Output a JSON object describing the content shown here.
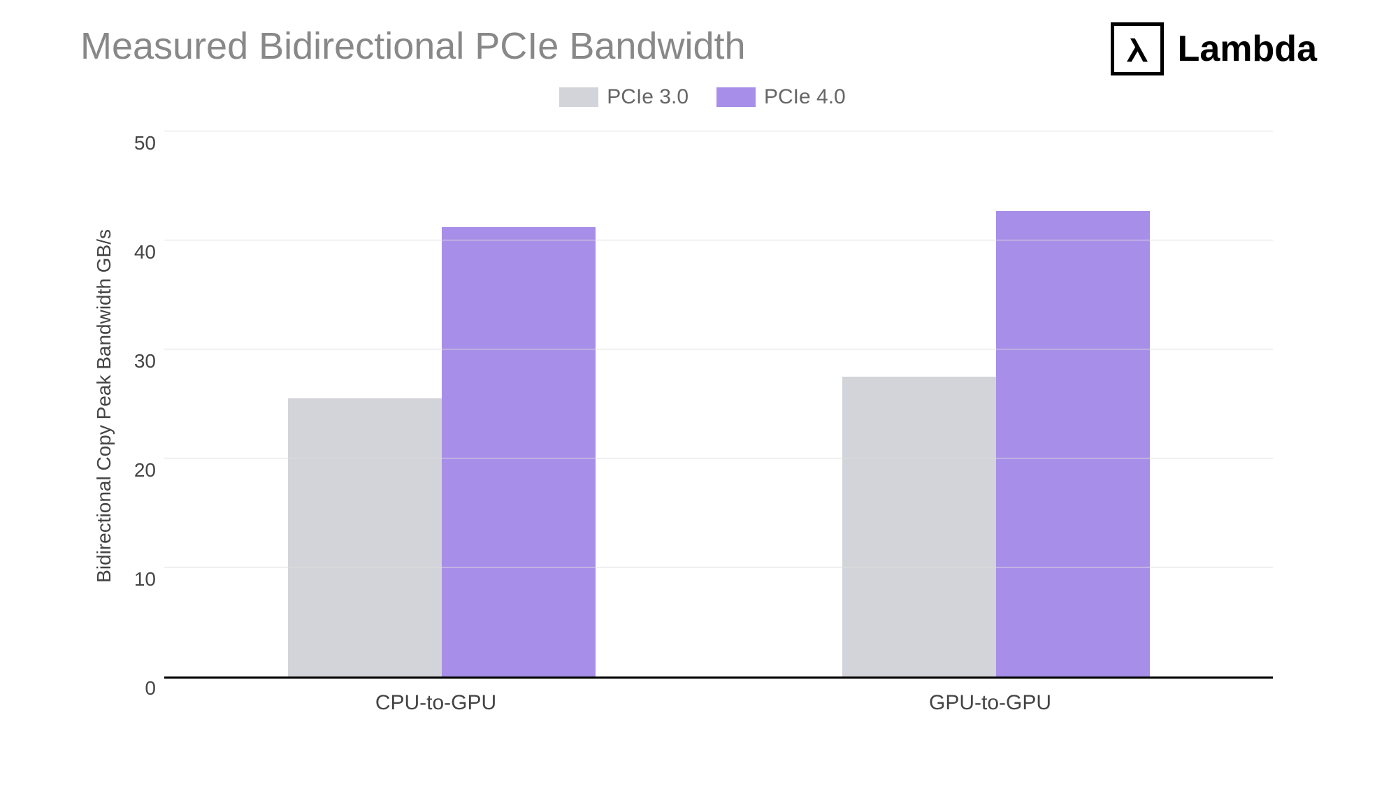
{
  "chart_data": {
    "type": "bar",
    "title": "Measured Bidirectional PCIe Bandwidth",
    "ylabel": "Bidirectional Copy Peak Bandwidth GB/s",
    "xlabel": "",
    "ylim": [
      0,
      50
    ],
    "yticks": [
      0,
      10,
      20,
      30,
      40,
      50
    ],
    "categories": [
      "CPU-to-GPU",
      "GPU-to-GPU"
    ],
    "series": [
      {
        "name": "PCIe 3.0",
        "color": "#d2d4d9",
        "values": [
          25.5,
          27.5
        ]
      },
      {
        "name": "PCIe 4.0",
        "color": "#a78ee8",
        "values": [
          41.2,
          42.7
        ]
      }
    ]
  },
  "logo": {
    "symbol": "λ",
    "text": "Lambda"
  }
}
